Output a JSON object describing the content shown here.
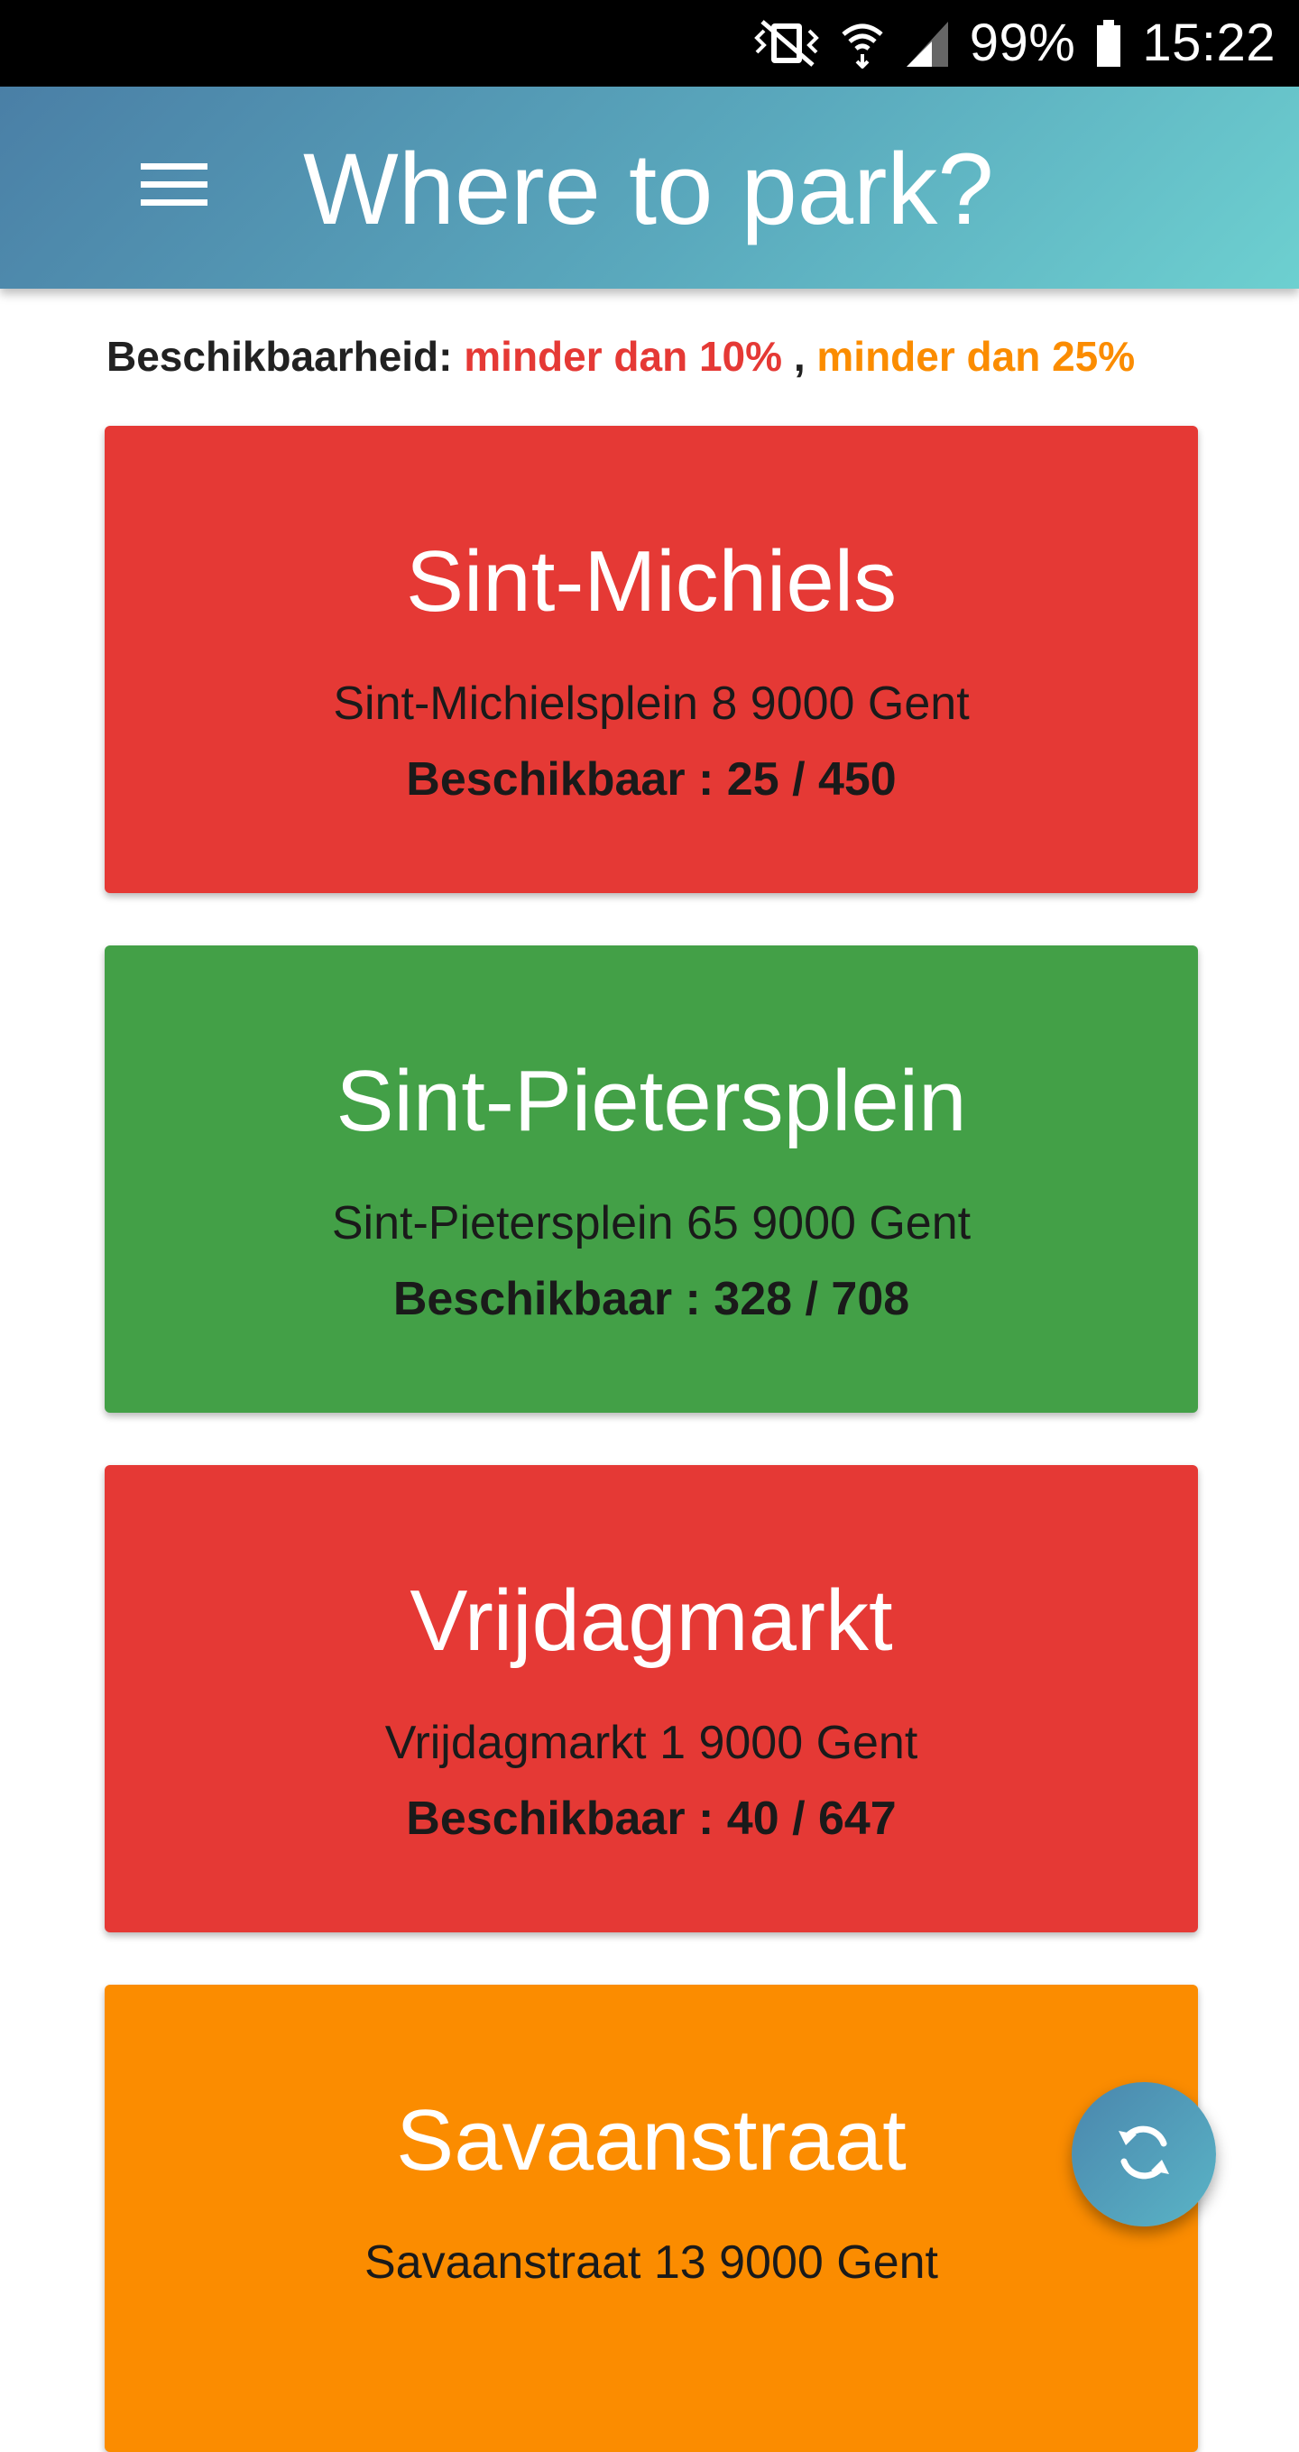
{
  "status_bar": {
    "battery": "99%",
    "time": "15:22",
    "icons": [
      "vibrate-icon",
      "wifi-icon",
      "signal-icon",
      "battery-icon"
    ]
  },
  "app_bar": {
    "title": "Where to park?",
    "menu_icon": "hamburger-menu-icon",
    "color_start": "#4a7fa6",
    "color_end": "#6dd0d0"
  },
  "legend": {
    "label": "Beschikbaarheid:",
    "low": "minder dan 10%",
    "separator": ",",
    "medium": "minder dan 25%",
    "low_color": "#e53935",
    "medium_color": "#fb8c00"
  },
  "parkings": [
    {
      "name": "Sint-Michiels",
      "address": "Sint-Michielsplein 8 9000 Gent",
      "availability": "Beschikbaar : 25 / 450",
      "color": "#e53935"
    },
    {
      "name": "Sint-Pietersplein",
      "address": "Sint-Pietersplein 65 9000 Gent",
      "availability": "Beschikbaar : 328 / 708",
      "color": "#43a047"
    },
    {
      "name": "Vrijdagmarkt",
      "address": "Vrijdagmarkt 1 9000 Gent",
      "availability": "Beschikbaar : 40 / 647",
      "color": "#e53935"
    },
    {
      "name": "Savaanstraat",
      "address": "Savaanstraat 13 9000 Gent",
      "availability": "",
      "color": "#fb8c00"
    }
  ],
  "fab": {
    "icon": "refresh-icon"
  }
}
